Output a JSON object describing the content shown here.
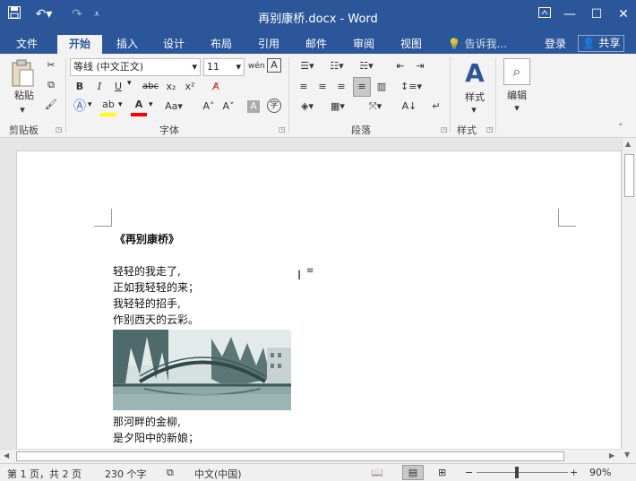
{
  "window": {
    "title": "再别康桥.docx - Word"
  },
  "qat": {
    "save_icon": "save-icon",
    "undo_icon": "undo-icon",
    "redo_icon": "redo-icon"
  },
  "tabs": [
    "文件",
    "开始",
    "插入",
    "设计",
    "布局",
    "引用",
    "邮件",
    "审阅",
    "视图"
  ],
  "active_tab": "开始",
  "tell_me": "告诉我...",
  "login": "登录",
  "share": "共享",
  "ribbon": {
    "paste": "粘贴",
    "font_name": "等线 (中文正文)",
    "font_size": "11",
    "styles": "样式",
    "edit": "编辑",
    "groups": [
      "剪贴板",
      "字体",
      "段落",
      "样式"
    ]
  },
  "document": {
    "title": "《再别康桥》",
    "lines1": [
      "轻轻的我走了,",
      "正如我轻轻的来；",
      "我轻轻的招手,",
      "作别西天的云彩。"
    ],
    "lines2": [
      "那河畔的金柳,",
      "是夕阳中的新娘；"
    ]
  },
  "status": {
    "page": "第 1 页，共 2 页",
    "words": "230 个字",
    "lang": "中文(中国)",
    "zoom": "90%",
    "zoom_level": 0.9
  },
  "colors": {
    "brand": "#2b579a",
    "highlight": "#ffff00",
    "font_color": "#ff0000"
  }
}
